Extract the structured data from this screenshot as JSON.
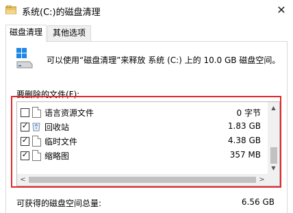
{
  "window": {
    "title": "系统(C:)的磁盘清理",
    "close_glyph": "✕"
  },
  "tabs": [
    {
      "label": "磁盘清理",
      "active": true
    },
    {
      "label": "其他选项",
      "active": false
    }
  ],
  "info": {
    "message": "可以使用“磁盘清理”来释放 系统 (C:) 上的 10.0 GB 磁盘空间。"
  },
  "files_section": {
    "label": "要删除的文件(F):",
    "items": [
      {
        "label": "语言资源文件",
        "size": "0 字节",
        "checked": false,
        "icon": "file-icon"
      },
      {
        "label": "回收站",
        "size": "1.83 GB",
        "checked": true,
        "icon": "recycle-bin-icon"
      },
      {
        "label": "临时文件",
        "size": "4.38 GB",
        "checked": true,
        "icon": "file-icon"
      },
      {
        "label": "缩略图",
        "size": "357 MB",
        "checked": true,
        "icon": "file-icon"
      }
    ],
    "check_glyph": "✓"
  },
  "scroll": {
    "up": "▲",
    "down": "▼",
    "left": "<",
    "right": ">"
  },
  "total": {
    "label": "可获得的磁盘空间总量:",
    "value": "6.56 GB"
  },
  "colors": {
    "highlight": "#e0242a",
    "windows_logo": "#1e88e5"
  }
}
